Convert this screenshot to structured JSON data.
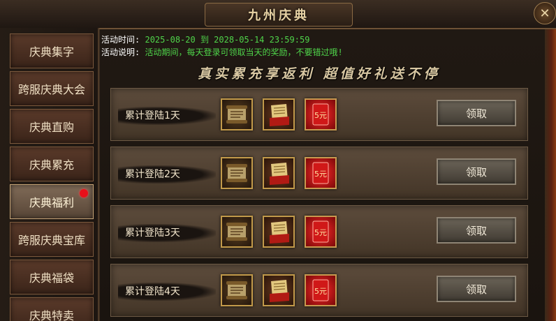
{
  "window": {
    "title": "九州庆典",
    "close_icon": "close-icon"
  },
  "sidebar": {
    "items": [
      {
        "label": "庆典集字",
        "active": false,
        "badge": false
      },
      {
        "label": "跨服庆典大会",
        "active": false,
        "badge": false
      },
      {
        "label": "庆典直购",
        "active": false,
        "badge": false
      },
      {
        "label": "庆典累充",
        "active": false,
        "badge": false
      },
      {
        "label": "庆典福利",
        "active": true,
        "badge": true
      },
      {
        "label": "跨服庆典宝库",
        "active": false,
        "badge": false
      },
      {
        "label": "庆典福袋",
        "active": false,
        "badge": false
      },
      {
        "label": "庆典特卖",
        "active": false,
        "badge": false
      }
    ]
  },
  "activity": {
    "time_label": "活动时间:",
    "time_value": "2025-08-20 到 2028-05-14 23:59:59",
    "desc_label": "活动说明:",
    "desc_value": "活动期间，每天登录可领取当天的奖励，不要错过哦!",
    "slogan": "真实累充享返利 超值好礼送不停"
  },
  "rewards": [
    {
      "label": "累计登陆1天",
      "button": "领取",
      "items": [
        "scroll-reward-icon",
        "gold-scroll-reward-icon",
        "red-envelope-icon"
      ],
      "envelope_text": "5元"
    },
    {
      "label": "累计登陆2天",
      "button": "领取",
      "items": [
        "scroll-reward-icon",
        "gold-scroll-reward-icon",
        "red-envelope-icon"
      ],
      "envelope_text": "5元"
    },
    {
      "label": "累计登陆3天",
      "button": "领取",
      "items": [
        "scroll-reward-icon",
        "gold-scroll-reward-icon",
        "red-envelope-icon"
      ],
      "envelope_text": "5元"
    },
    {
      "label": "累计登陆4天",
      "button": "领取",
      "items": [
        "scroll-reward-icon",
        "gold-scroll-reward-icon",
        "red-envelope-icon"
      ],
      "envelope_text": "5元"
    }
  ],
  "colors": {
    "info_value": "#4fd44a",
    "badge": "#e8101a",
    "item_border": "#c29a4a"
  }
}
